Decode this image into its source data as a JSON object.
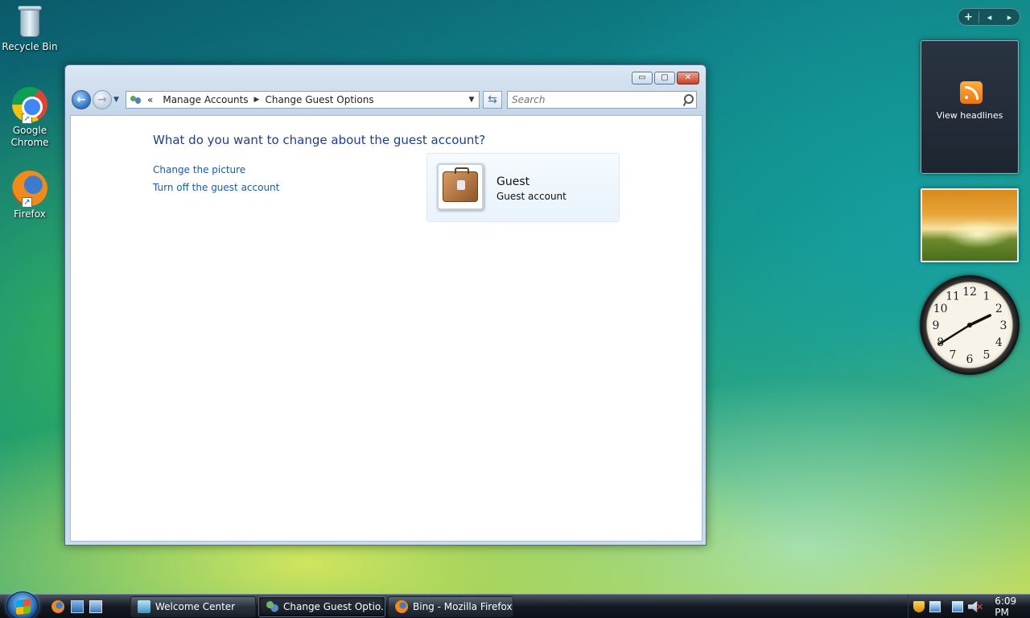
{
  "desktop": {
    "icons": [
      {
        "label": "Recycle Bin"
      },
      {
        "label": "Google\nChrome"
      },
      {
        "label": "Firefox"
      }
    ]
  },
  "window": {
    "controls": {
      "minimize": "▭",
      "maximize": "▢",
      "close": "✕"
    },
    "breadcrumb": {
      "overflow": "«",
      "items": [
        "Manage Accounts",
        "Change Guest Options"
      ]
    },
    "search": {
      "placeholder": "Search"
    },
    "content": {
      "heading": "What do you want to change about the guest account?",
      "tasks": [
        "Change the picture",
        "Turn off the guest account"
      ],
      "account": {
        "name": "Guest",
        "type": "Guest account"
      }
    }
  },
  "gadgets": {
    "feed": {
      "label": "View headlines"
    },
    "clock": {
      "hours": 2,
      "minutes": 9,
      "numbers": [
        "12",
        "1",
        "2",
        "3",
        "4",
        "5",
        "6",
        "7",
        "8",
        "9",
        "10",
        "11"
      ]
    }
  },
  "taskbar": {
    "buttons": [
      {
        "label": "Welcome Center"
      },
      {
        "label": "Change Guest Optio..."
      },
      {
        "label": "Bing - Mozilla Firefox"
      }
    ],
    "tray": {
      "time": "6:09 PM"
    }
  }
}
